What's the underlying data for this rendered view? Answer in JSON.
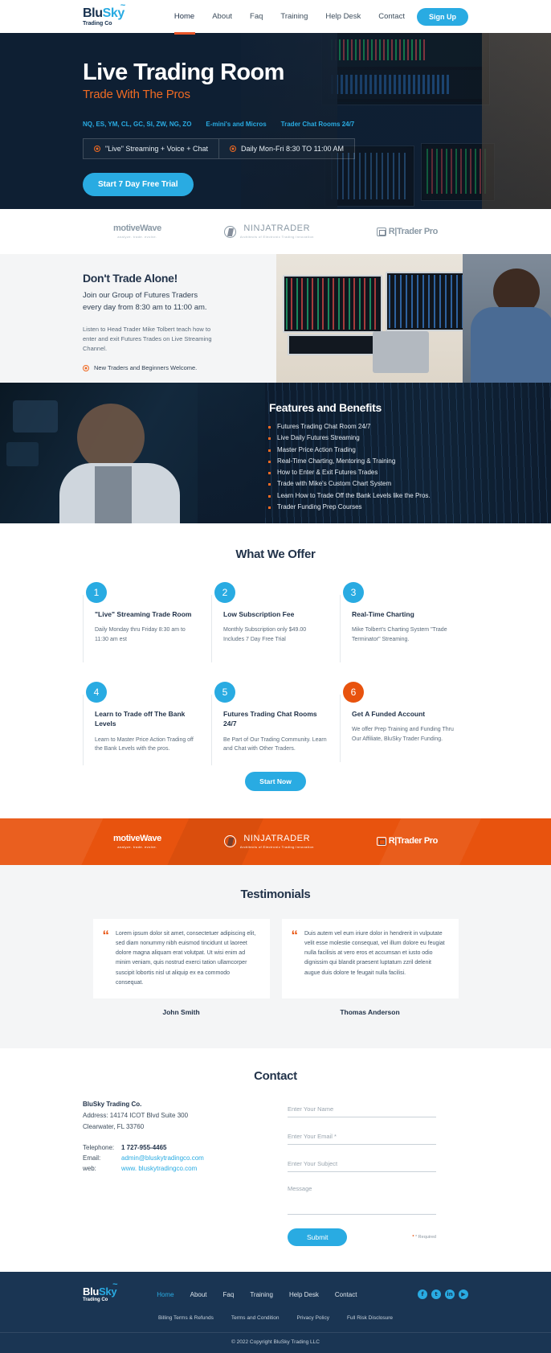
{
  "header": {
    "logo": {
      "part1": "Blu",
      "part2": "Sky",
      "sub": "Trading Co"
    },
    "nav": [
      "Home",
      "About",
      "Faq",
      "Training",
      "Help Desk",
      "Contact"
    ],
    "signup_label": "Sign Up"
  },
  "hero": {
    "title": "Live Trading Room",
    "subtitle": "Trade With The Pros",
    "tickers": [
      "NQ, ES, YM, CL, GC, SI, ZW, NG, ZO",
      "E-mini's and Micros",
      "Trader Chat Rooms 24/7"
    ],
    "bar": [
      "\"Live\"  Streaming + Voice + Chat",
      "Daily Mon-Fri 8:30 TO 11:00 AM"
    ],
    "cta_label": "Start 7 Day Free Trial"
  },
  "partners": [
    {
      "name": "motiveWave",
      "tagline": "analyze. trade. evolve."
    },
    {
      "name": "NINJATRADER",
      "tagline": "Architects of Electronic Trading Innovation"
    },
    {
      "name": "R|Trader Pro",
      "tagline": ""
    }
  ],
  "dont_trade_alone": {
    "heading": "Don't Trade Alone!",
    "lead": "Join our Group of Futures Traders\never y day from 8:30 am to 11:00 am.",
    "lead_line1": "Join our Group of Futures Traders",
    "lead_line2": "every day from 8:30 am to 11:00 am.",
    "body": "Listen to Head Trader Mike Tolbert teach how to enter and exit Futures Trades on Live Streaming Channel.",
    "bullet": "New Traders and Beginners Welcome."
  },
  "features": {
    "heading": "Features and Benefits",
    "items": [
      "Futures Trading Chat Room 24/7",
      "Live Daily Futures Streaming",
      "Master Price Action Trading",
      "Real-Time Charting, Mentoring & Training",
      "How to Enter & Exit Futures Trades",
      "Trade with Mike's Custom Chart System",
      "Learn How to Trade Off the Bank Levels like the Pros.",
      "Trader Funding Prep Courses"
    ]
  },
  "offer": {
    "title": "What We Offer",
    "cards": [
      {
        "num": "1",
        "title": "\"Live\" Streaming Trade Room",
        "text": "Daily Monday thru Friday 8:30 am to 11:30 am est",
        "accent": false
      },
      {
        "num": "2",
        "title": "Low Subscription Fee",
        "text": "Monthly Subscription only $49.00 Includes 7 Day Free Trial",
        "accent": false
      },
      {
        "num": "3",
        "title": "Real-Time Charting",
        "text": "Mike Tolbert's  Charting System \"Trade Terminator\" Streaming.",
        "accent": false
      },
      {
        "num": "4",
        "title": "Learn to Trade off The Bank Levels",
        "text": "Learn to Master Price Action Trading off the Bank Levels with the pros.",
        "accent": false
      },
      {
        "num": "5",
        "title": "Futures Trading Chat Rooms 24/7",
        "text": "Be Part of Our Trading Community. Learn and Chat with Other Traders.",
        "accent": false
      },
      {
        "num": "6",
        "title": "Get A Funded Account",
        "text": "We offer Prep Training and Funding Thru Our Affiliate, BluSky Trader Funding.",
        "accent": true
      }
    ],
    "start_label": "Start Now"
  },
  "testimonials": {
    "title": "Testimonials",
    "items": [
      {
        "quote": "Lorem ipsum dolor sit amet, consectetuer adipiscing elit, sed diam nonummy nibh euismod tincidunt ut laoreet dolore magna aliquam erat volutpat. Ut wisi enim ad minim veniam, quis nostrud exerci tation ullamcorper suscipit lobortis nisl ut aliquip ex ea commodo consequat.",
        "author": "John Smith"
      },
      {
        "quote": "Duis autem vel eum iriure dolor in hendrerit in vulputate velit esse molestie consequat, vel illum dolore eu feugiat nulla facilisis at vero eros et accumsan et iusto odio dignissim qui blandit praesent luptatum zzril delenit augue duis dolore te feugait nulla facilisi.",
        "author": "Thomas Anderson"
      }
    ]
  },
  "contact": {
    "title": "Contact",
    "company": "BluSky Trading Co.",
    "address_line1": "Address: 14174 ICOT Blvd Suite 300",
    "address_line2": "Clearwater, FL 33760",
    "rows": [
      {
        "key": "Telephone:",
        "value": "1 727-955-4465",
        "dark": true
      },
      {
        "key": "Email:",
        "value": "admin@bluskytradingco.com",
        "dark": false
      },
      {
        "key": "web:",
        "value": "www. bluskytradingco.com",
        "dark": false
      }
    ],
    "form": {
      "name_placeholder": "Enter Your Name",
      "email_placeholder": "Enter Your Email *",
      "subject_placeholder": "Enter Your Subject",
      "message_placeholder": "Message",
      "submit_label": "Submit",
      "required_note": "* Required"
    }
  },
  "footer": {
    "logo": {
      "part1": "Blu",
      "part2": "Sky",
      "sub": "Trading Co"
    },
    "nav": [
      "Home",
      "About",
      "Faq",
      "Training",
      "Help Desk",
      "Contact"
    ],
    "social": [
      "facebook-icon",
      "twitter-icon",
      "linkedin-icon",
      "youtube-icon"
    ],
    "social_glyphs": [
      "f",
      "t",
      "in",
      "▶"
    ],
    "links": [
      "Billing Terms & Refunds",
      "Terms and Condition",
      "Privacy Policy",
      "Full Risk Disclosure"
    ],
    "copyright": "© 2022 Copyright BluSky Trading  LLC"
  },
  "colors": {
    "brand_blue": "#29abe2",
    "accent_orange": "#e8530e",
    "navy": "#1a3553",
    "dark": "#22334a"
  }
}
